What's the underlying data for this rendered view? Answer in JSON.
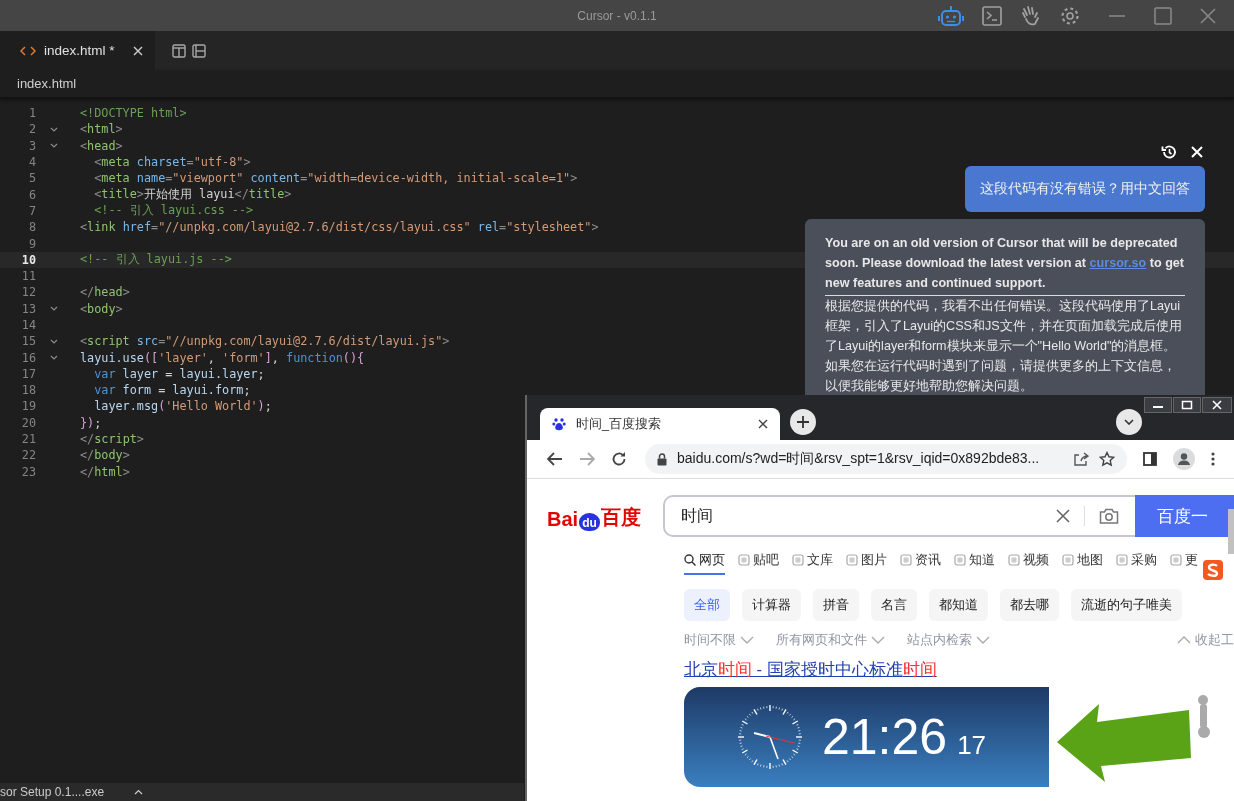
{
  "window": {
    "title": "Cursor - v0.1.1"
  },
  "editor_tabs": [
    {
      "label": "index.html *",
      "selected": true
    }
  ],
  "breadcrumb": "index.html",
  "code_lines": [
    {
      "number": "1",
      "fold": false,
      "current": false,
      "tokens": [
        {
          "kind": "doctype",
          "text": "<!DOCTYPE html>"
        }
      ]
    },
    {
      "number": "2",
      "fold": true,
      "current": false,
      "tokens": [
        {
          "kind": "punct",
          "text": "<"
        },
        {
          "kind": "tag",
          "text": "html"
        },
        {
          "kind": "punct",
          "text": ">"
        }
      ]
    },
    {
      "number": "3",
      "fold": true,
      "current": false,
      "tokens": [
        {
          "kind": "punct",
          "text": "<"
        },
        {
          "kind": "tag",
          "text": "head"
        },
        {
          "kind": "punct",
          "text": ">"
        }
      ]
    },
    {
      "number": "4",
      "fold": false,
      "current": false,
      "tokens": [
        {
          "kind": "punct",
          "text": "  <"
        },
        {
          "kind": "tag",
          "text": "meta"
        },
        {
          "kind": "attr",
          "text": " charset"
        },
        {
          "kind": "punct",
          "text": "="
        },
        {
          "kind": "string",
          "text": "\"utf-8\""
        },
        {
          "kind": "punct",
          "text": ">"
        }
      ]
    },
    {
      "number": "5",
      "fold": false,
      "current": false,
      "tokens": [
        {
          "kind": "punct",
          "text": "  <"
        },
        {
          "kind": "tag",
          "text": "meta"
        },
        {
          "kind": "attr",
          "text": " name"
        },
        {
          "kind": "punct",
          "text": "="
        },
        {
          "kind": "string",
          "text": "\"viewport\""
        },
        {
          "kind": "attr",
          "text": " content"
        },
        {
          "kind": "punct",
          "text": "="
        },
        {
          "kind": "string",
          "text": "\"width=device-width, initial-scale=1\""
        },
        {
          "kind": "punct",
          "text": ">"
        }
      ]
    },
    {
      "number": "6",
      "fold": false,
      "current": false,
      "tokens": [
        {
          "kind": "punct",
          "text": "  <"
        },
        {
          "kind": "tag",
          "text": "title"
        },
        {
          "kind": "punct",
          "text": ">"
        },
        {
          "kind": "text",
          "text": "开始使用 layui"
        },
        {
          "kind": "punct",
          "text": "</"
        },
        {
          "kind": "tag",
          "text": "title"
        },
        {
          "kind": "punct",
          "text": ">"
        }
      ]
    },
    {
      "number": "7",
      "fold": false,
      "current": false,
      "tokens": [
        {
          "kind": "comment",
          "text": "  <!-- 引入 layui.css -->"
        }
      ]
    },
    {
      "number": "8",
      "fold": false,
      "current": false,
      "tokens": [
        {
          "kind": "punct",
          "text": "<"
        },
        {
          "kind": "tag",
          "text": "link"
        },
        {
          "kind": "attr",
          "text": " href"
        },
        {
          "kind": "punct",
          "text": "="
        },
        {
          "kind": "string",
          "text": "\"//unpkg.com/layui@2.7.6/dist/css/layui.css\""
        },
        {
          "kind": "attr",
          "text": " rel"
        },
        {
          "kind": "punct",
          "text": "="
        },
        {
          "kind": "string",
          "text": "\"stylesheet\""
        },
        {
          "kind": "punct",
          "text": ">"
        }
      ]
    },
    {
      "number": "9",
      "fold": false,
      "current": false
    },
    {
      "number": "10",
      "fold": false,
      "current": true,
      "tokens": [
        {
          "kind": "comment",
          "text": "<!-- 引入 layui.js -->"
        }
      ]
    },
    {
      "number": "11",
      "fold": false,
      "current": false
    },
    {
      "number": "12",
      "fold": false,
      "current": false,
      "tokens": [
        {
          "kind": "punct",
          "text": "</"
        },
        {
          "kind": "tag",
          "text": "head"
        },
        {
          "kind": "punct",
          "text": ">"
        }
      ]
    },
    {
      "number": "13",
      "fold": true,
      "current": false,
      "tokens": [
        {
          "kind": "punct",
          "text": "<"
        },
        {
          "kind": "tag",
          "text": "body"
        },
        {
          "kind": "punct",
          "text": ">"
        }
      ]
    },
    {
      "number": "14",
      "fold": false,
      "current": false
    },
    {
      "number": "15",
      "fold": true,
      "current": false,
      "tokens": [
        {
          "kind": "punct",
          "text": "<"
        },
        {
          "kind": "tag",
          "text": "script"
        },
        {
          "kind": "attr",
          "text": " src"
        },
        {
          "kind": "punct",
          "text": "="
        },
        {
          "kind": "string",
          "text": "\"//unpkg.com/layui@2.7.6/dist/layui.js\""
        },
        {
          "kind": "punct",
          "text": ">"
        }
      ]
    },
    {
      "number": "16",
      "fold": true,
      "current": false,
      "tokens": [
        {
          "kind": "ident",
          "text": "layui.use"
        },
        {
          "kind": "bracket",
          "text": "(["
        },
        {
          "kind": "string",
          "text": "'layer'"
        },
        {
          "kind": "text",
          "text": ", "
        },
        {
          "kind": "string",
          "text": "'form'"
        },
        {
          "kind": "bracket",
          "text": "]"
        },
        {
          "kind": "text",
          "text": ", "
        },
        {
          "kind": "keyword",
          "text": "function"
        },
        {
          "kind": "bracket",
          "text": "(){"
        }
      ]
    },
    {
      "number": "17",
      "fold": false,
      "current": false,
      "tokens": [
        {
          "kind": "keyword",
          "text": "  var"
        },
        {
          "kind": "ident",
          "text": " layer"
        },
        {
          "kind": "text",
          "text": " = "
        },
        {
          "kind": "ident",
          "text": "layui.layer"
        },
        {
          "kind": "text",
          "text": ";"
        }
      ]
    },
    {
      "number": "18",
      "fold": false,
      "current": false,
      "tokens": [
        {
          "kind": "keyword",
          "text": "  var"
        },
        {
          "kind": "ident",
          "text": " form"
        },
        {
          "kind": "text",
          "text": " = "
        },
        {
          "kind": "ident",
          "text": "layui.form"
        },
        {
          "kind": "text",
          "text": ";"
        }
      ]
    },
    {
      "number": "19",
      "fold": false,
      "current": false,
      "tokens": [
        {
          "kind": "ident",
          "text": "  layer.msg"
        },
        {
          "kind": "bracket",
          "text": "("
        },
        {
          "kind": "string",
          "text": "'Hello World'"
        },
        {
          "kind": "bracket",
          "text": ")"
        },
        {
          "kind": "text",
          "text": ";"
        }
      ]
    },
    {
      "number": "20",
      "fold": false,
      "current": false,
      "tokens": [
        {
          "kind": "bracket",
          "text": "})"
        },
        {
          "kind": "text",
          "text": ";"
        }
      ]
    },
    {
      "number": "21",
      "fold": false,
      "current": false,
      "tokens": [
        {
          "kind": "punct",
          "text": "</"
        },
        {
          "kind": "tag",
          "text": "script"
        },
        {
          "kind": "punct",
          "text": ">"
        }
      ]
    },
    {
      "number": "22",
      "fold": false,
      "current": false,
      "tokens": [
        {
          "kind": "punct",
          "text": "</"
        },
        {
          "kind": "tag",
          "text": "body"
        },
        {
          "kind": "punct",
          "text": ">"
        }
      ]
    },
    {
      "number": "23",
      "fold": false,
      "current": false,
      "tokens": [
        {
          "kind": "punct",
          "text": "</"
        },
        {
          "kind": "tag",
          "text": "html"
        },
        {
          "kind": "punct",
          "text": ">"
        }
      ]
    }
  ],
  "chat": {
    "question": "这段代码有没有错误？用中文回答",
    "notice": {
      "before": "You are on an old version of Cursor that will be deprecated soon. Please download the latest version at ",
      "link": "cursor.so",
      "after": " to get new features and continued support."
    },
    "answer": "根据您提供的代码，我看不出任何错误。这段代码使用了Layui框架，引入了Layui的CSS和JS文件，并在页面加载完成后使用了Layui的layer和form模块来显示一个\"Hello World\"的消息框。如果您在运行代码时遇到了问题，请提供更多的上下文信息，以便我能够更好地帮助您解决问题。"
  },
  "browser": {
    "tabs": [
      {
        "label": "时间_百度搜索",
        "selected": true
      }
    ],
    "url": "baidu.com/s?wd=时间&rsv_spt=1&rsv_iqid=0x892bde83...",
    "logo": {
      "left": "Bai",
      "middle": "du",
      "right": "百度"
    },
    "search": {
      "value": "时间",
      "button": "百度一"
    },
    "nav": [
      {
        "label": "网页",
        "selected": true
      },
      {
        "label": "贴吧",
        "selected": false
      },
      {
        "label": "文库",
        "selected": false
      },
      {
        "label": "图片",
        "selected": false
      },
      {
        "label": "资讯",
        "selected": false
      },
      {
        "label": "知道",
        "selected": false
      },
      {
        "label": "视频",
        "selected": false
      },
      {
        "label": "地图",
        "selected": false
      },
      {
        "label": "采购",
        "selected": false
      },
      {
        "label": "更",
        "selected": false
      }
    ],
    "chips": [
      {
        "label": "全部",
        "selected": true
      },
      {
        "label": "计算器",
        "selected": false
      },
      {
        "label": "拼音",
        "selected": false
      },
      {
        "label": "名言",
        "selected": false
      },
      {
        "label": "都知道",
        "selected": false
      },
      {
        "label": "都去哪",
        "selected": false
      },
      {
        "label": "流逝的句子唯美",
        "selected": false
      }
    ],
    "filters": [
      "时间不限",
      "所有网页和文件",
      "站点内检索"
    ],
    "collapse": "收起工",
    "result_title": [
      {
        "text": "北京",
        "highlight": false
      },
      {
        "text": "时间",
        "highlight": true
      },
      {
        "text": " - 国家授时中心标准",
        "highlight": false
      },
      {
        "text": "时间",
        "highlight": true
      }
    ],
    "clock": {
      "time": "21:26",
      "seconds": "17"
    }
  },
  "downloads": {
    "file": "sor Setup 0.1....exe"
  }
}
